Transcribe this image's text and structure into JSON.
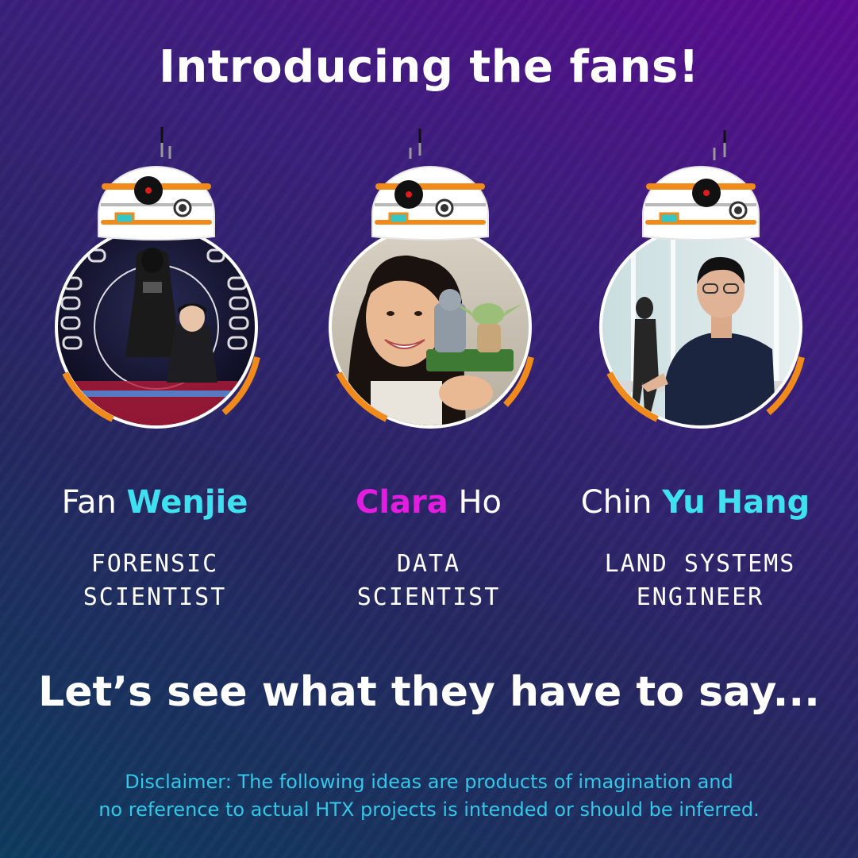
{
  "title": "Introducing the fans!",
  "colors": {
    "cyan": "#3fe0ef",
    "magenta": "#e21de0",
    "bb8_orange": "#f08a1a",
    "disclaimer": "#33c7e8"
  },
  "fans": [
    {
      "first": "Fan",
      "highlight": "Wenjie",
      "highlight_color": "#3fe0ef",
      "highlight_first": false,
      "role": [
        "FORENSIC",
        "SCIENTIST"
      ],
      "photo_icon": "photo-fan-wenjie"
    },
    {
      "first": "Ho",
      "highlight": "Clara",
      "highlight_color": "#e21de0",
      "highlight_first": true,
      "role": [
        "DATA",
        "SCIENTIST"
      ],
      "photo_icon": "photo-clara-ho"
    },
    {
      "first": "Chin",
      "highlight": "Yu Hang",
      "highlight_color": "#3fe0ef",
      "highlight_first": false,
      "role": [
        "LAND SYSTEMS",
        "ENGINEER"
      ],
      "photo_icon": "photo-chin-yu-hang"
    }
  ],
  "tagline": "Let’s see what they have to say...",
  "disclaimer": [
    "Disclaimer: The following ideas are products of imagination and",
    "no reference to actual HTX projects is intended or should be inferred."
  ]
}
